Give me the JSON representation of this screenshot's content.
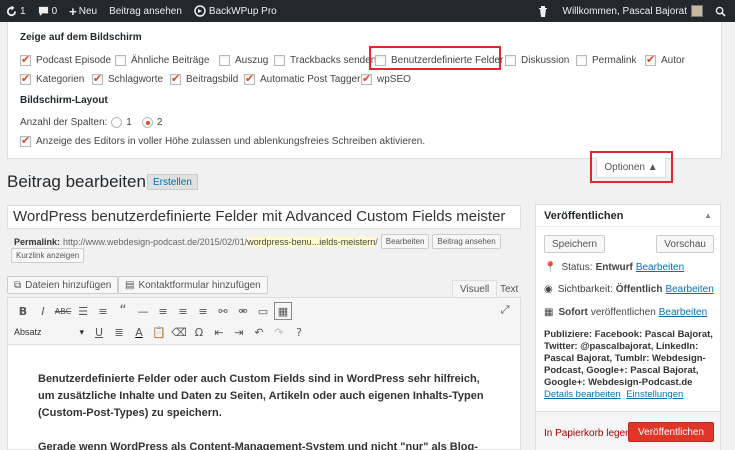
{
  "adminbar": {
    "updates_count": "1",
    "comments_count": "0",
    "new_label": "Neu",
    "view_post": "Beitrag ansehen",
    "plugin_label": "BackWPup Pro",
    "greeting": "Willkommen, Pascal Bajorat"
  },
  "screen_options": {
    "heading_screen": "Zeige auf dem Bildschirm",
    "boxes": [
      {
        "label": "Podcast Episode",
        "checked": true
      },
      {
        "label": "Ähnliche Beiträge",
        "checked": false
      },
      {
        "label": "Auszug",
        "checked": false
      },
      {
        "label": "Trackbacks senden",
        "checked": false
      },
      {
        "label": "Benutzerdefinierte Felder",
        "checked": false
      },
      {
        "label": "Diskussion",
        "checked": false
      },
      {
        "label": "Permalink",
        "checked": false
      },
      {
        "label": "Autor",
        "checked": true
      },
      {
        "label": "Kategorien",
        "checked": true
      },
      {
        "label": "Schlagworte",
        "checked": true
      },
      {
        "label": "Beitragsbild",
        "checked": true
      },
      {
        "label": "Automatic Post Tagger",
        "checked": true
      },
      {
        "label": "wpSEO",
        "checked": true
      }
    ],
    "heading_layout": "Bildschirm-Layout",
    "columns_label": "Anzahl der Spalten:",
    "col_1": "1",
    "col_2": "2",
    "selected_columns": 2,
    "fullheight_label": "Anzeige des Editors in voller Höhe zulassen und ablenkungsfreies Schreiben aktivieren.",
    "fullheight_checked": true,
    "options_tab": "Optionen ▲"
  },
  "page": {
    "title": "Beitrag bearbeiten",
    "add_new": "Erstellen"
  },
  "post": {
    "title": "WordPress benutzerdefinierte Felder mit Advanced Custom Fields meister",
    "permalink_label": "Permalink:",
    "permalink_base": "http://www.webdesign-podcast.de/2015/02/01/",
    "permalink_slug": "wordpress-benu...ields-meistern",
    "permalink_end": "/",
    "edit_btn": "Bearbeiten",
    "view_btn": "Beitrag ansehen",
    "shortlink_btn": "Kurzlink anzeigen"
  },
  "editor": {
    "add_media": "Dateien hinzufügen",
    "add_form": "Kontaktformular hinzufügen",
    "tab_visual": "Visuell",
    "tab_text": "Text",
    "format": "Absatz",
    "paragraph1": "Benutzerdefinierte Felder oder auch Custom Fields sind in WordPress sehr hilfreich, um zusätzliche Inhalte und Daten zu Seiten, Artikeln oder auch eigenen Inhalts-Typen (Custom-Post-Types) zu speichern.",
    "paragraph2": "Gerade wenn WordPress als Content-Management-System und nicht \"nur\" als Blog-"
  },
  "publish": {
    "heading": "Veröffentlichen",
    "save_btn": "Speichern",
    "preview_btn": "Vorschau",
    "status_label": "Status:",
    "status_value": "Entwurf",
    "visibility_label": "Sichtbarkeit:",
    "visibility_value": "Öffentlich",
    "schedule_value": "Sofort",
    "schedule_suffix": "veröffentlichen",
    "edit_link": "Bearbeiten",
    "social_text": "Publiziere: Facebook: Pascal Bajorat, Twitter: @pascalbajorat, LinkedIn: Pascal Bajorat, Tumblr: Webdesign-Podcast, Google+: Pascal Bajorat, Google+: Webdesign-Podcast.de",
    "details_edit": "Details bearbeiten",
    "settings": "Einstellungen",
    "trash": "In Papierkorb legen",
    "publish_btn": "Veröffentlichen"
  }
}
